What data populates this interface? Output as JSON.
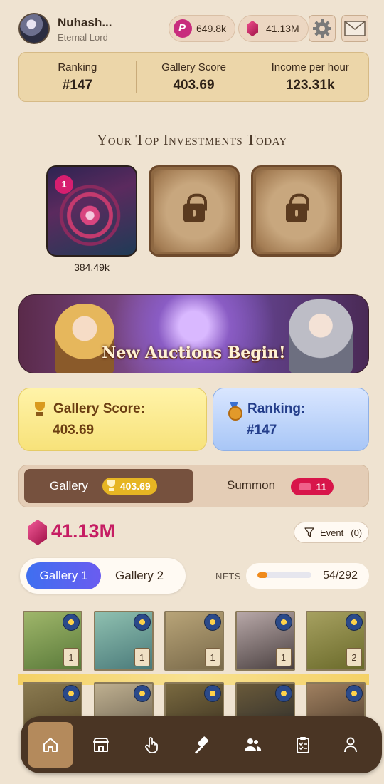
{
  "user": {
    "name": "Nuhash...",
    "title": "Eternal Lord"
  },
  "currencies": {
    "coins": "649.8k",
    "gems": "41.13M"
  },
  "stats": [
    {
      "label": "Ranking",
      "value": "#147"
    },
    {
      "label": "Gallery Score",
      "value": "403.69"
    },
    {
      "label": "Income per hour",
      "value": "123.31k"
    }
  ],
  "investments": {
    "title": "Your Top Investments Today",
    "items": [
      {
        "rank": "1",
        "value": "384.49k"
      }
    ]
  },
  "banner": {
    "text": "New Auctions Begin!"
  },
  "score_cards": {
    "gallery": {
      "label": "Gallery Score:",
      "value": "403.69"
    },
    "ranking": {
      "label": "Ranking:",
      "value": "#147"
    }
  },
  "tabs": {
    "gallery": {
      "label": "Gallery",
      "badge": "403.69"
    },
    "summon": {
      "label": "Summon",
      "badge": "11"
    }
  },
  "gems_total": "41.13M",
  "event_filter": {
    "label": "Event",
    "count": "(0)"
  },
  "gallery_switch": {
    "items": [
      "Gallery 1",
      "Gallery 2"
    ],
    "active": "Gallery 1"
  },
  "nfts": {
    "label": "NFTS",
    "count": "54/292",
    "progress": 0.185
  },
  "grid_cards": [
    {
      "num": "1",
      "colors": [
        "#5a7a3a",
        "#9fb66a"
      ]
    },
    {
      "num": "1",
      "colors": [
        "#4a7a7a",
        "#8fc0b0"
      ]
    },
    {
      "num": "1",
      "colors": [
        "#7a6a4a",
        "#b8a478"
      ]
    },
    {
      "num": "1",
      "colors": [
        "#4a4040",
        "#b8a8a8"
      ]
    },
    {
      "num": "2",
      "colors": [
        "#6a6a2a",
        "#a6a060"
      ]
    },
    {
      "num": "",
      "colors": [
        "#5a4a2a",
        "#8a7a50"
      ]
    },
    {
      "num": "",
      "colors": [
        "#6a6050",
        "#bfb090"
      ]
    },
    {
      "num": "",
      "colors": [
        "#3a3020",
        "#7a6a40"
      ]
    },
    {
      "num": "",
      "colors": [
        "#2a2a2a",
        "#6a5a3a"
      ]
    },
    {
      "num": "",
      "colors": [
        "#4a3a2a",
        "#a08060"
      ]
    }
  ],
  "nav": [
    "home",
    "shop",
    "tap",
    "auction",
    "friends",
    "tasks",
    "profile"
  ],
  "colors": {
    "accent": "#c61d63",
    "brown": "#4a3524",
    "gallery_tab": "#76513e"
  }
}
